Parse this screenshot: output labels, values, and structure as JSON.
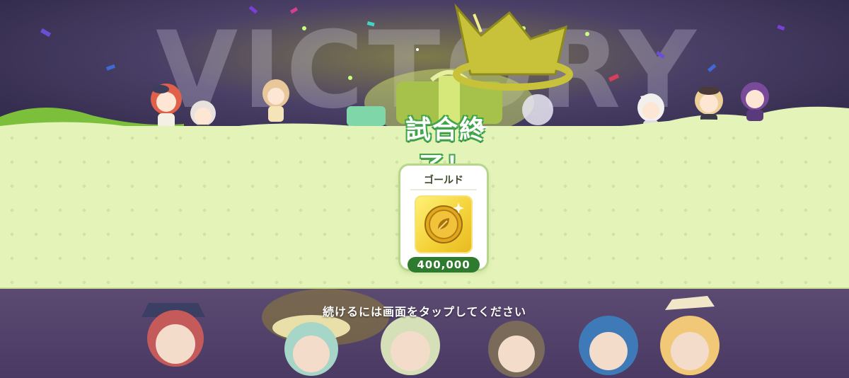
{
  "background": {
    "banner_text": "VICTORY"
  },
  "result": {
    "title": "試合終了！"
  },
  "reward": {
    "name": "ゴールド",
    "icon": "gold-coin-icon",
    "amount": "400,000"
  },
  "prompt": {
    "continue_text": "続けるには画面をタップしてください"
  },
  "colors": {
    "panel": "#e4f3b8",
    "title_outline": "#3fa64a",
    "amount_badge": "#2e7a2e",
    "coin": "#f4d33a"
  }
}
